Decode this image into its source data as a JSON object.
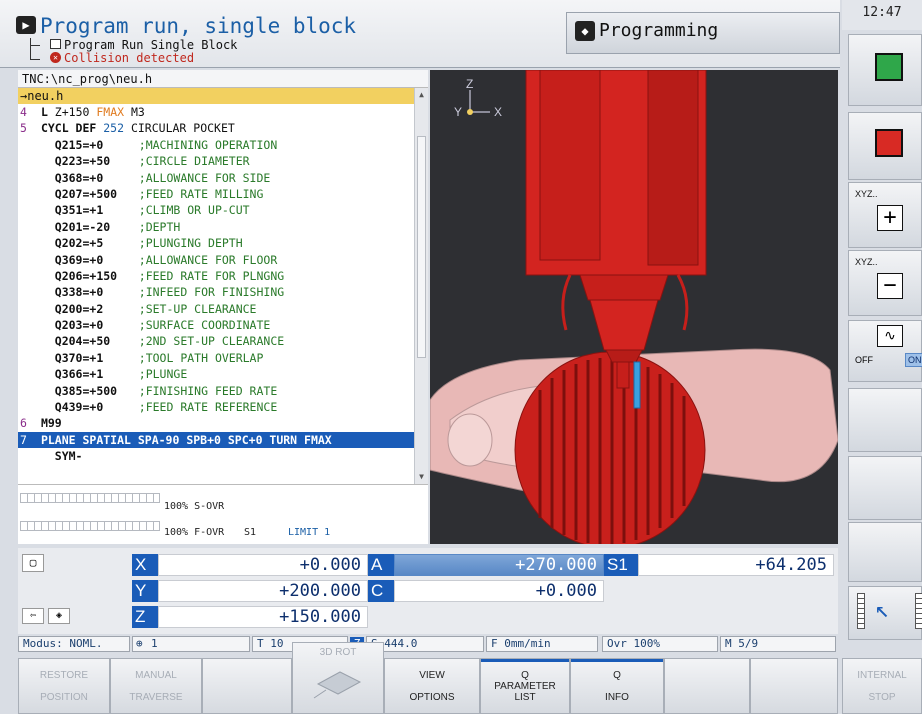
{
  "header": {
    "mode_title": "Program run, single block",
    "sub_line1": "Program Run Single Block",
    "sub_line2": "Collision detected",
    "programming_label": "Programming",
    "clock": "12:47"
  },
  "program": {
    "path": "TNC:\\nc_prog\\neu.h",
    "file": "→neu.h",
    "lines": [
      {
        "n": "4",
        "cmd": "L",
        "rest": " Z+150 ",
        "fmax": "FMAX",
        "tail": " M3",
        "type": "main"
      },
      {
        "n": "5",
        "cmd": "CYCL DEF",
        "num": " 252",
        "tail": " CIRCULAR POCKET",
        "type": "main"
      },
      {
        "n": "",
        "q": "Q215=+0",
        "c": ";MACHINING OPERATION",
        "type": "param"
      },
      {
        "n": "",
        "q": "Q223=+50",
        "c": ";CIRCLE DIAMETER",
        "type": "param"
      },
      {
        "n": "",
        "q": "Q368=+0",
        "c": ";ALLOWANCE FOR SIDE",
        "type": "param"
      },
      {
        "n": "",
        "q": "Q207=+500",
        "c": ";FEED RATE MILLING",
        "type": "param"
      },
      {
        "n": "",
        "q": "Q351=+1",
        "c": ";CLIMB OR UP-CUT",
        "type": "param"
      },
      {
        "n": "",
        "q": "Q201=-20",
        "c": ";DEPTH",
        "type": "param"
      },
      {
        "n": "",
        "q": "Q202=+5",
        "c": ";PLUNGING DEPTH",
        "type": "param"
      },
      {
        "n": "",
        "q": "Q369=+0",
        "c": ";ALLOWANCE FOR FLOOR",
        "type": "param"
      },
      {
        "n": "",
        "q": "Q206=+150",
        "c": ";FEED RATE FOR PLNGNG",
        "type": "param"
      },
      {
        "n": "",
        "q": "Q338=+0",
        "c": ";INFEED FOR FINISHING",
        "type": "param"
      },
      {
        "n": "",
        "q": "Q200=+2",
        "c": ";SET-UP CLEARANCE",
        "type": "param"
      },
      {
        "n": "",
        "q": "Q203=+0",
        "c": ";SURFACE COORDINATE",
        "type": "param"
      },
      {
        "n": "",
        "q": "Q204=+50",
        "c": ";2ND SET-UP CLEARANCE",
        "type": "param"
      },
      {
        "n": "",
        "q": "Q370=+1",
        "c": ";TOOL PATH OVERLAP",
        "type": "param"
      },
      {
        "n": "",
        "q": "Q366=+1",
        "c": ";PLUNGE",
        "type": "param"
      },
      {
        "n": "",
        "q": "Q385=+500",
        "c": ";FINISHING FEED RATE",
        "type": "param"
      },
      {
        "n": "",
        "q": "Q439=+0",
        "c": ";FEED RATE REFERENCE",
        "type": "param"
      },
      {
        "n": "6",
        "cmd": "M99",
        "tail": "",
        "type": "main"
      },
      {
        "n": "7",
        "cmd": "PLANE SPATIAL SPA-90 SPB+0 SPC+0 TURN FMAX",
        "tail": "",
        "type": "selected"
      },
      {
        "n": "",
        "cmd": "SYM-",
        "tail": "",
        "type": "cont"
      }
    ]
  },
  "override": {
    "s_ovr": "100% S-OVR",
    "f_ovr": "100% F-OVR",
    "s1": "S1",
    "limit": "LIMIT 1"
  },
  "axes": {
    "x_label": "X",
    "x_value": "+0.000",
    "y_label": "Y",
    "y_value": "+200.000",
    "z_label": "Z",
    "z_value": "+150.000",
    "a_label": "A",
    "a_value": "+270.000",
    "c_label": "C",
    "c_value": "+0.000",
    "s1_label": "S1",
    "s1_value": "+64.205"
  },
  "graphic": {
    "axis_z": "Z",
    "axis_y": "Y",
    "axis_x": "X"
  },
  "status": {
    "modus": "Modus: NOML.",
    "datum": "1",
    "tool": "T 10",
    "tool_axis": "Z",
    "spindle": "S 444.0",
    "feed": "F 0mm/min",
    "ovr": "Ovr 100%",
    "m": "M 5/9"
  },
  "softkeys": {
    "restore_line1": "RESTORE",
    "restore_line2": "POSITION",
    "manual_line1": "MANUAL",
    "manual_line2": "TRAVERSE",
    "rot3d": "3D ROT",
    "view_line1": "VIEW",
    "view_line2": "OPTIONS",
    "qparam_line1": "Q",
    "qparam_line2": "PARAMETER",
    "qparam_line3": "LIST",
    "qinfo_line1": "Q",
    "qinfo_line2": "INFO",
    "internal_line1": "INTERNAL",
    "internal_line2": "STOP"
  },
  "vsoftkeys": {
    "xyz_plus": "XYZ..",
    "xyz_minus": "XYZ..",
    "off": "OFF",
    "on": "ON"
  },
  "colors": {
    "accent_blue": "#1a5cb8",
    "tool_red": "#d32420",
    "error_red": "#c0281e",
    "file_yellow": "#f2d060"
  }
}
